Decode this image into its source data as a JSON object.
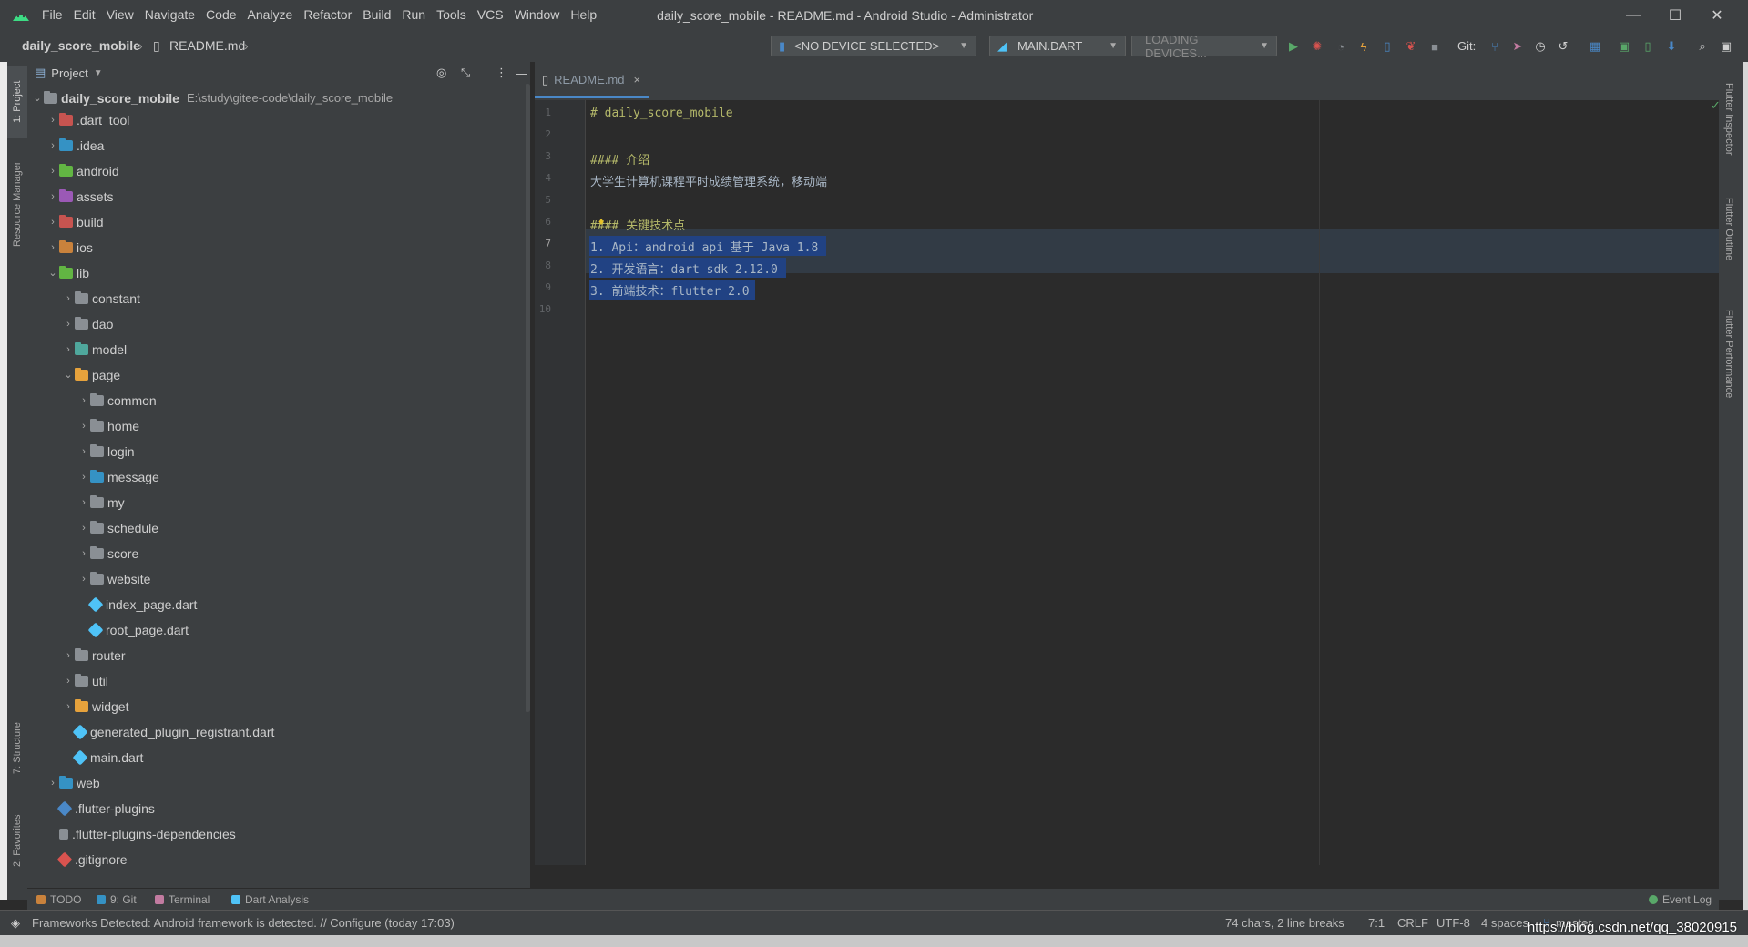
{
  "window": {
    "title": "daily_score_mobile - README.md - Android Studio - Administrator",
    "menu": [
      "File",
      "Edit",
      "View",
      "Navigate",
      "Code",
      "Analyze",
      "Refactor",
      "Build",
      "Run",
      "Tools",
      "VCS",
      "Window",
      "Help"
    ],
    "controls": {
      "minimize": "—",
      "maximize": "☐",
      "close": "✕"
    }
  },
  "breadcrumb": {
    "project": "daily_score_mobile",
    "file": "README.md"
  },
  "toolbar": {
    "device_selector": "<NO DEVICE SELECTED>",
    "run_config": "MAIN.DART",
    "loading_devices": "LOADING DEVICES...",
    "git_label": "Git:"
  },
  "left_tabs": {
    "project": "1: Project",
    "resource": "Resource Manager",
    "structure": "7: Structure",
    "favorites": "2: Favorites"
  },
  "right_tabs": {
    "inspector": "Flutter Inspector",
    "outline": "Flutter Outline",
    "performance": "Flutter Performance"
  },
  "project_panel": {
    "header": "Project",
    "root": {
      "name": "daily_score_mobile",
      "path": "E:\\study\\gitee-code\\daily_score_mobile"
    },
    "items": [
      {
        "name": ".dart_tool",
        "depth": 1,
        "expanded": false,
        "kind": "folder",
        "color": "#c75450"
      },
      {
        "name": ".idea",
        "depth": 1,
        "expanded": false,
        "kind": "folder",
        "color": "#3592c4"
      },
      {
        "name": "android",
        "depth": 1,
        "expanded": false,
        "kind": "folder",
        "color": "#62b543"
      },
      {
        "name": "assets",
        "depth": 1,
        "expanded": false,
        "kind": "folder",
        "color": "#9b59b6"
      },
      {
        "name": "build",
        "depth": 1,
        "expanded": false,
        "kind": "folder",
        "color": "#c75450"
      },
      {
        "name": "ios",
        "depth": 1,
        "expanded": false,
        "kind": "folder",
        "color": "#c9823c"
      },
      {
        "name": "lib",
        "depth": 1,
        "expanded": true,
        "kind": "folder",
        "color": "#62b543"
      },
      {
        "name": "constant",
        "depth": 2,
        "expanded": false,
        "kind": "folder",
        "color": "#8a8f94"
      },
      {
        "name": "dao",
        "depth": 2,
        "expanded": false,
        "kind": "folder",
        "color": "#8a8f94"
      },
      {
        "name": "model",
        "depth": 2,
        "expanded": false,
        "kind": "folder",
        "color": "#4fa79c"
      },
      {
        "name": "page",
        "depth": 2,
        "expanded": true,
        "kind": "folder",
        "color": "#e6a23c"
      },
      {
        "name": "common",
        "depth": 3,
        "expanded": false,
        "kind": "folder",
        "color": "#8a8f94"
      },
      {
        "name": "home",
        "depth": 3,
        "expanded": false,
        "kind": "folder",
        "color": "#8a8f94"
      },
      {
        "name": "login",
        "depth": 3,
        "expanded": false,
        "kind": "folder",
        "color": "#8a8f94"
      },
      {
        "name": "message",
        "depth": 3,
        "expanded": false,
        "kind": "folder",
        "color": "#3592c4"
      },
      {
        "name": "my",
        "depth": 3,
        "expanded": false,
        "kind": "folder",
        "color": "#8a8f94"
      },
      {
        "name": "schedule",
        "depth": 3,
        "expanded": false,
        "kind": "folder",
        "color": "#8a8f94"
      },
      {
        "name": "score",
        "depth": 3,
        "expanded": false,
        "kind": "folder",
        "color": "#8a8f94"
      },
      {
        "name": "website",
        "depth": 3,
        "expanded": false,
        "kind": "folder",
        "color": "#8a8f94"
      },
      {
        "name": "index_page.dart",
        "depth": 3,
        "kind": "dart"
      },
      {
        "name": "root_page.dart",
        "depth": 3,
        "kind": "dart"
      },
      {
        "name": "router",
        "depth": 2,
        "expanded": false,
        "kind": "folder",
        "color": "#8a8f94"
      },
      {
        "name": "util",
        "depth": 2,
        "expanded": false,
        "kind": "folder",
        "color": "#8a8f94"
      },
      {
        "name": "widget",
        "depth": 2,
        "expanded": false,
        "kind": "folder",
        "color": "#e6a23c"
      },
      {
        "name": "generated_plugin_registrant.dart",
        "depth": 2,
        "kind": "dart"
      },
      {
        "name": "main.dart",
        "depth": 2,
        "kind": "dart"
      },
      {
        "name": "web",
        "depth": 1,
        "expanded": false,
        "kind": "folder",
        "color": "#3592c4"
      },
      {
        "name": ".flutter-plugins",
        "depth": 1,
        "kind": "flutter"
      },
      {
        "name": ".flutter-plugins-dependencies",
        "depth": 1,
        "kind": "file"
      },
      {
        "name": ".gitignore",
        "depth": 1,
        "kind": "git"
      }
    ]
  },
  "editor": {
    "tab": {
      "label": "README.md",
      "close": "×"
    },
    "lines": [
      {
        "n": "1",
        "text": "# daily_score_mobile",
        "heading": true
      },
      {
        "n": "2",
        "text": ""
      },
      {
        "n": "3",
        "text": "#### 介绍",
        "heading": true
      },
      {
        "n": "4",
        "text": "大学生计算机课程平时成绩管理系统，移动端"
      },
      {
        "n": "5",
        "text": ""
      },
      {
        "n": "6",
        "text": "#### 关键技术点",
        "heading": true
      },
      {
        "n": "7",
        "text": "1. Api：android api 基于 Java 1.8"
      },
      {
        "n": "8",
        "text": "2. 开发语言：dart sdk 2.12.0"
      },
      {
        "n": "9",
        "text": "3. 前端技术：flutter 2.0"
      },
      {
        "n": "10",
        "text": ""
      }
    ]
  },
  "bottom_tabs": [
    {
      "label": "TODO",
      "color": "#c9823c"
    },
    {
      "label": "9: Git",
      "color": "#3592c4"
    },
    {
      "label": "Terminal",
      "color": "#c27ba0"
    },
    {
      "label": "Dart Analysis",
      "color": "#4fc3f7"
    }
  ],
  "event_log": "Event Log",
  "status": {
    "message": "Frameworks Detected: Android framework is detected. // Configure (today 17:03)",
    "chars": "74 chars, 2 line breaks",
    "position": "7:1",
    "line_sep": "CRLF",
    "encoding": "UTF-8",
    "indent": "4 spaces",
    "branch": "master"
  },
  "watermark": "https://blog.csdn.net/qq_38020915"
}
